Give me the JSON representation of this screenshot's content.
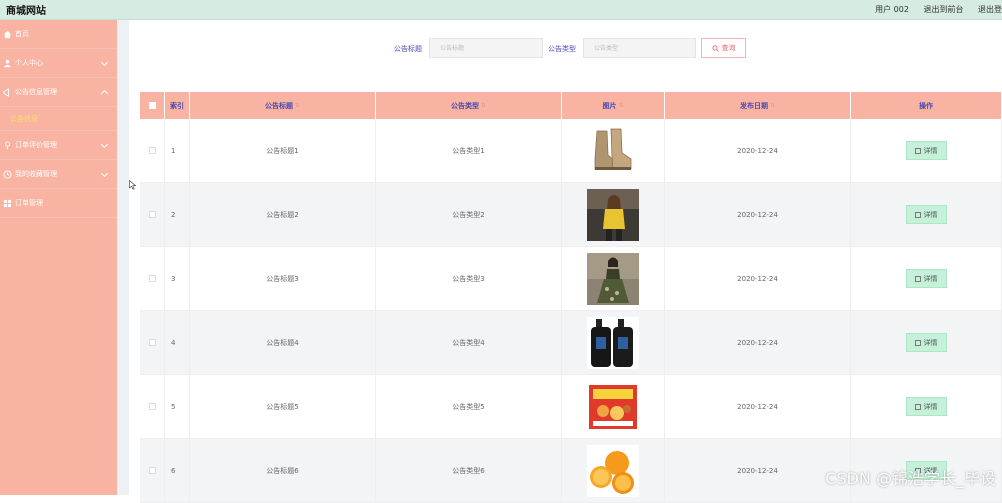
{
  "header": {
    "site_title": "商城网站",
    "nav": {
      "user": "用户 002",
      "front": "退出到前台",
      "logout": "退出登"
    }
  },
  "sidebar": {
    "items": [
      {
        "label": "首页",
        "icon": "home-icon"
      },
      {
        "label": "个人中心",
        "icon": "user-icon",
        "expandable": true
      },
      {
        "label": "公告信息管理",
        "icon": "megaphone-icon",
        "expandable": true,
        "open": true,
        "sub": [
          "公告信息"
        ]
      },
      {
        "label": "订单评价管理",
        "icon": "pin-icon",
        "expandable": true
      },
      {
        "label": "我的收藏管理",
        "icon": "clock-icon",
        "expandable": true
      },
      {
        "label": "订单管理",
        "icon": "grid-icon"
      }
    ]
  },
  "search": {
    "title_label": "公告标题",
    "title_placeholder": "公告标题",
    "type_label": "公告类型",
    "type_placeholder": "公告类型",
    "button": "查询"
  },
  "table": {
    "headers": [
      "索引",
      "公告标题",
      "公告类型",
      "图片",
      "发布日期",
      "操作"
    ],
    "detail_label": "详情",
    "rows": [
      {
        "index": "1",
        "title": "公告标题1",
        "type": "公告类型1",
        "image": "boots",
        "date": "2020-12-24"
      },
      {
        "index": "2",
        "title": "公告标题2",
        "type": "公告类型2",
        "image": "woman-yellow",
        "date": "2020-12-24"
      },
      {
        "index": "3",
        "title": "公告标题3",
        "type": "公告类型3",
        "image": "woman-green",
        "date": "2020-12-24"
      },
      {
        "index": "4",
        "title": "公告标题4",
        "type": "公告类型4",
        "image": "bottles",
        "date": "2020-12-24"
      },
      {
        "index": "5",
        "title": "公告标题5",
        "type": "公告类型5",
        "image": "snack-box",
        "date": "2020-12-24"
      },
      {
        "index": "6",
        "title": "公告标题6",
        "type": "公告类型6",
        "image": "oranges",
        "date": "2020-12-24"
      }
    ]
  },
  "watermark": "CSDN @锦浩学长_毕设",
  "colors": {
    "sidebar": "#f9b3a2",
    "topbar": "#d6ebe1",
    "header_text": "#4a4ab0",
    "sub_active": "#f6e26b",
    "detail_btn": "#c5f0d9"
  }
}
